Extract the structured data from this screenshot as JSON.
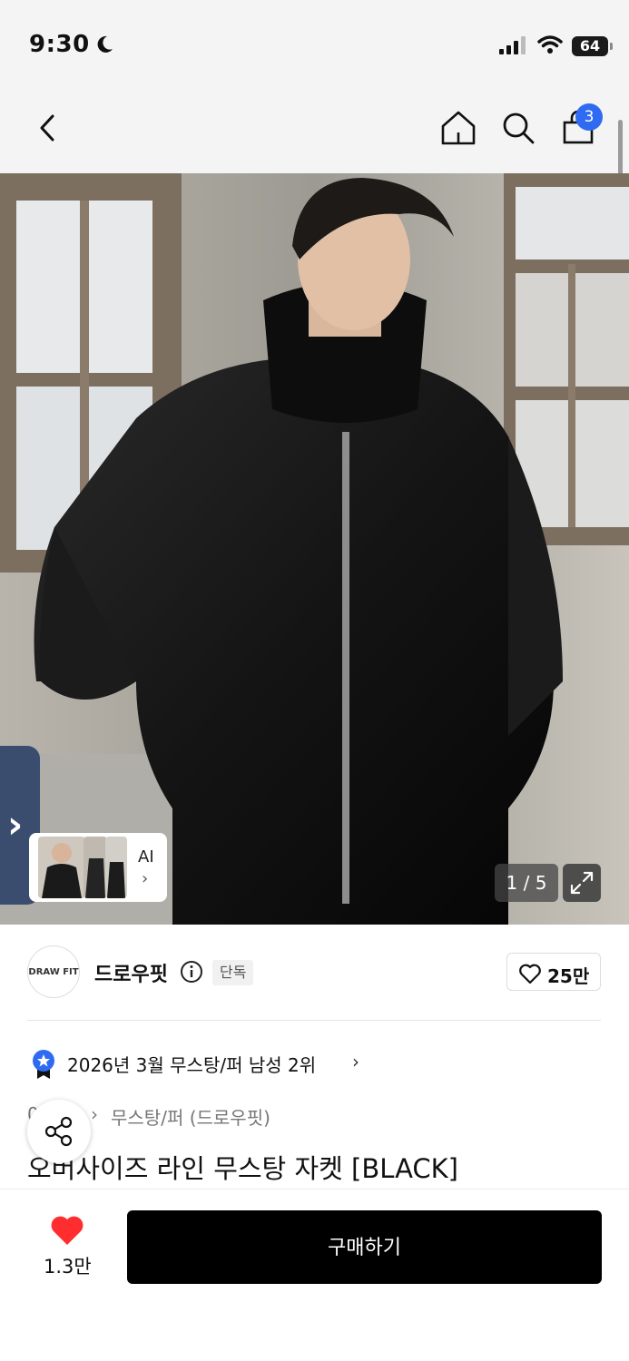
{
  "status_bar": {
    "time": "9:30",
    "battery": "64"
  },
  "header": {
    "cart_count": "3",
    "icons": [
      "back-arrow-icon",
      "home-icon",
      "search-icon",
      "shopping-bag-icon"
    ]
  },
  "gallery": {
    "pager": "1 / 5",
    "ai_label": "AI",
    "ai_chevron": "›",
    "side_chevron": "›"
  },
  "brand": {
    "logo_text": "DRAW FIT",
    "name": "드로우핏",
    "badge": "단독",
    "likes": "25만"
  },
  "ranking": {
    "text": "2026년 3월 무스탕/퍼 남성 2위",
    "chevron": "›"
  },
  "breadcrumb": {
    "prefix": "0",
    "separator": "›",
    "category": "무스탕/퍼 (드로우핏)"
  },
  "product": {
    "title": "오버사이즈 라인 무스탕 자켓 [BLACK]"
  },
  "bottom": {
    "wish_count": "1.3만",
    "buy_label": "구매하기"
  },
  "colors": {
    "accent_blue": "#2f6bf2",
    "heart_red": "#ff2d2d",
    "buy_bg": "#000000"
  }
}
